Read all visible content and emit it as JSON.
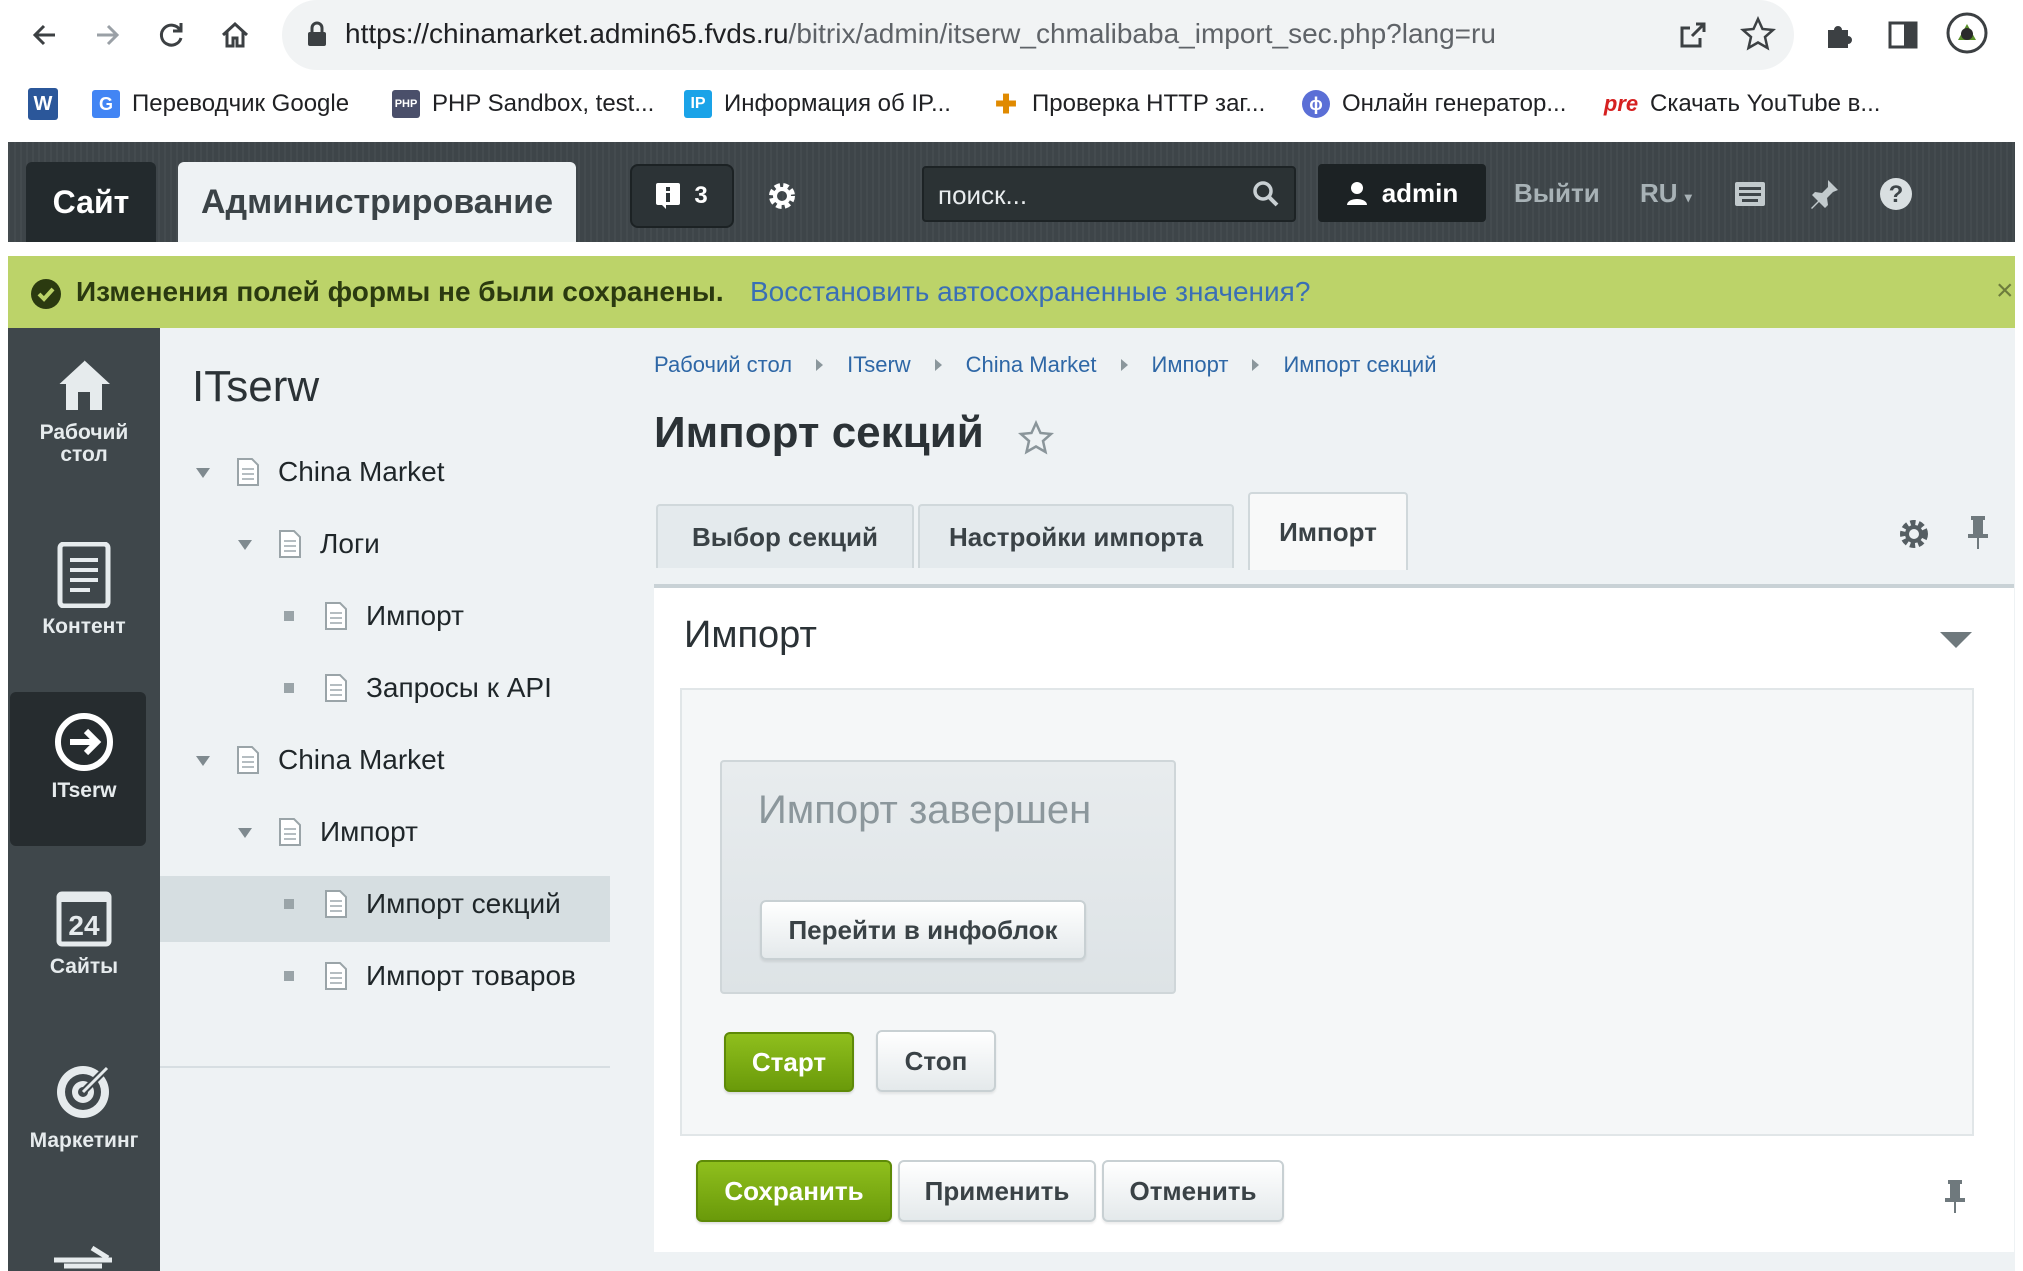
{
  "browser": {
    "url_host": "https://chinamarket.admin65.fvds.ru",
    "url_path": "/bitrix/admin/itserw_chmalibaba_import_sec.php?lang=ru",
    "bookmarks": [
      {
        "label": "Переводчик Google",
        "icon": "google-translate-icon"
      },
      {
        "label": "PHP Sandbox, test...",
        "icon": "php-icon"
      },
      {
        "label": "Информация об IP...",
        "icon": "ip-icon"
      },
      {
        "label": "Проверка HTTP заг...",
        "icon": "http-check-icon"
      },
      {
        "label": "Онлайн генератор...",
        "icon": "generator-icon"
      },
      {
        "label": "Скачать YouTube в...",
        "icon": "pre-icon"
      }
    ],
    "bookmark_w": "W",
    "bookmark_ip": "IP",
    "bookmark_pre": "pre",
    "bookmark_php": "PHP"
  },
  "admin_bar": {
    "site_tab": "Сайт",
    "admin_tab": "Администрирование",
    "notifications_count": "3",
    "search_placeholder": "поиск...",
    "user": "admin",
    "logout": "Выйти",
    "language": "RU"
  },
  "notice": {
    "message": "Изменения полей формы не были сохранены.",
    "link": "Восстановить автосохраненные значения?",
    "close": "×"
  },
  "rail": [
    {
      "label_line1": "Рабочий",
      "label_line2": "стол",
      "icon": "home-icon"
    },
    {
      "label_line1": "Контент",
      "label_line2": "",
      "icon": "content-icon"
    },
    {
      "label_line1": "ITserw",
      "label_line2": "",
      "icon": "arrow-circle-icon",
      "active": true
    },
    {
      "label_line1": "Сайты",
      "label_line2": "",
      "icon": "calendar-icon",
      "icon_text": "24"
    },
    {
      "label_line1": "Маркетинг",
      "label_line2": "",
      "icon": "target-icon"
    }
  ],
  "subnav": {
    "title": "ITserw",
    "tree": [
      {
        "label": "China Market",
        "level": 0,
        "type": "folder"
      },
      {
        "label": "Логи",
        "level": 1,
        "type": "folder"
      },
      {
        "label": "Импорт",
        "level": 2,
        "type": "leaf"
      },
      {
        "label": "Запросы к API",
        "level": 2,
        "type": "leaf"
      },
      {
        "label": "China Market",
        "level": 0,
        "type": "folder"
      },
      {
        "label": "Импорт",
        "level": 1,
        "type": "folder"
      },
      {
        "label": "Импорт секций",
        "level": 2,
        "type": "leaf",
        "selected": true
      },
      {
        "label": "Импорт товаров",
        "level": 2,
        "type": "leaf"
      }
    ]
  },
  "main": {
    "breadcrumb": [
      "Рабочий стол",
      "ITserw",
      "China Market",
      "Импорт",
      "Импорт секций"
    ],
    "title": "Импорт секций",
    "tabs": [
      "Выбор секций",
      "Настройки импорта",
      "Импорт"
    ],
    "active_tab": "Импорт",
    "section_title": "Импорт",
    "status": "Импорт завершен",
    "goto_button": "Перейти в инфоблок",
    "start_button": "Старт",
    "stop_button": "Стоп",
    "save_button": "Сохранить",
    "apply_button": "Применить",
    "cancel_button": "Отменить"
  },
  "colors": {
    "accent_green": "#7aab12",
    "notice_bg": "#bcd369",
    "link_blue": "#3a6fb5",
    "header_dark": "#3e4549"
  }
}
